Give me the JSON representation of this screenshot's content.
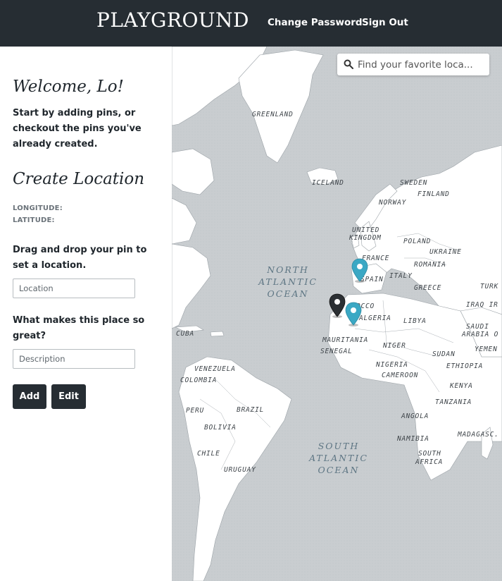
{
  "header": {
    "brand": "PLAYGROUND",
    "change_password": "Change Password",
    "sign_out": "Sign Out"
  },
  "sidebar": {
    "welcome": "Welcome, Lo!",
    "intro": "Start by adding pins, or checkout the pins you've already created.",
    "create_title": "Create Location",
    "longitude_label": "LONGITUDE:",
    "latitude_label": "LATITUDE:",
    "drag_prompt": "Drag and drop your pin to set a location.",
    "location_placeholder": "Location",
    "description_prompt": "What makes this place so great?",
    "description_placeholder": "Description",
    "add_label": "Add",
    "edit_label": "Edit"
  },
  "map": {
    "search_placeholder": "Find your favorite loca...",
    "labels": {
      "greenland": "GREENLAND",
      "iceland": "ICELAND",
      "sweden": "SWEDEN",
      "finland": "FINLAND",
      "norway": "NORWAY",
      "united": "UNITED",
      "kingdom": "KINGDOM",
      "poland": "POLAND",
      "ukraine": "UKRAINE",
      "france": "FRANCE",
      "romania": "ROMANIA",
      "spain": "SPAIN",
      "italy": "ITALY",
      "greece": "GREECE",
      "turk": "TURK",
      "morocco": "OCCO",
      "algeria": "ALGERIA",
      "libya": "LIBYA",
      "iraq": "IRAQ IR",
      "saudi": "SAUDI",
      "arabia": "ARABIA O",
      "cuba": "CUBA",
      "mauritania": "MAURITANIA",
      "niger": "NIGER",
      "senegal": "SENEGAL",
      "sudan": "SUDAN",
      "yemen": "YEMEN",
      "venezuela": "VENEZUELA",
      "colombia": "COLOMBIA",
      "nigeria": "NIGERIA",
      "ethiopia": "ETHIOPIA",
      "cameroon": "CAMEROON",
      "kenya": "KENYA",
      "peru": "PERU",
      "brazil": "BRAZIL",
      "tanzania": "TANZANIA",
      "bolivia": "BOLIVIA",
      "angola": "ANGOLA",
      "chile": "CHILE",
      "namibia": "NAMIBIA",
      "madagascar": "MADAGASC.",
      "south": "SOUTH",
      "africa": "AFRICA",
      "uruguay": "URUGUAY"
    },
    "oceans": {
      "north": "NORTH\nATLANTIC\nOCEAN",
      "south": "SOUTH\nATLANTIC\nOCEAN"
    },
    "colors": {
      "water": "#c9cdd0",
      "land": "#ffffff",
      "pin_teal": "#3ba8c4",
      "pin_dark": "#2b2f33"
    }
  }
}
